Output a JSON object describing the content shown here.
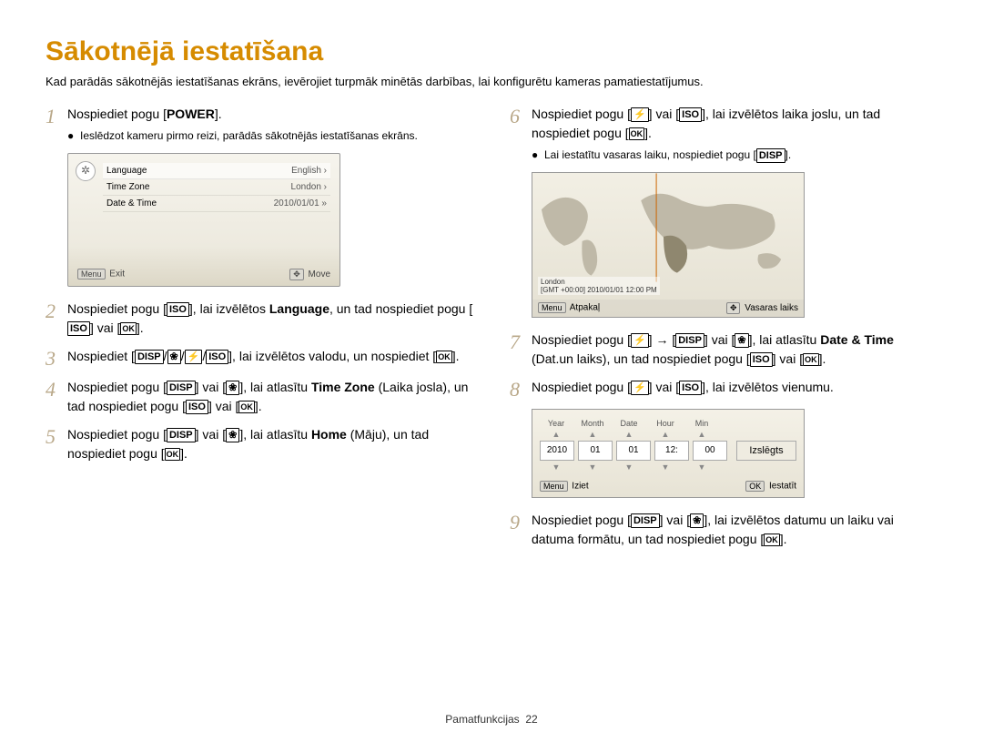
{
  "title": "Sākotnējā iestatīšana",
  "intro": "Kad parādās sākotnējās iestatīšanas ekrāns, ievērojiet turpmāk minētās darbības, lai konfigurētu kameras pamatiestatījumus.",
  "steps": {
    "s1_a": "Nospiediet pogu [",
    "s1_b": "POWER",
    "s1_c": "].",
    "s1_bullet": "Ieslēdzot kameru pirmo reizi, parādās sākotnējās iestatīšanas ekrāns.",
    "s2_a": "Nospiediet pogu [",
    "s2_b": "], lai izvēlētos ",
    "s2_lang": "Language",
    "s2_c": ", un tad nospiediet pogu [",
    "s2_d": "] vai [",
    "s2_e": "].",
    "s3_a": "Nospiediet [",
    "s3_b": "], lai izvēlētos valodu, un nospiediet [",
    "s3_c": "].",
    "s4_a": "Nospiediet pogu [",
    "s4_b": "] vai [",
    "s4_c": "], lai atlasītu ",
    "s4_tz": "Time Zone",
    "s4_d": " (Laika josla), un tad nospiediet pogu [",
    "s4_e": "] vai [",
    "s4_f": "].",
    "s5_a": "Nospiediet pogu [",
    "s5_b": "] vai [",
    "s5_c": "], lai atlasītu ",
    "s5_home": "Home",
    "s5_d": " (Māju), un tad nospiediet pogu [",
    "s5_e": "].",
    "s6_a": "Nospiediet pogu [",
    "s6_b": "] vai [",
    "s6_c": "], lai izvēlētos laika joslu, un tad nospiediet pogu [",
    "s6_d": "].",
    "s6_bullet_a": "Lai iestatītu vasaras laiku, nospiediet pogu [",
    "s6_bullet_b": "].",
    "s7_a": "Nospiediet pogu [",
    "s7_b": "] → [",
    "s7_c": "] vai [",
    "s7_d": "], lai atlasītu ",
    "s7_dt": "Date & Time",
    "s7_e": " (Dat.un laiks), un tad nospiediet pogu [",
    "s7_f": "] vai [",
    "s7_g": "].",
    "s8_a": "Nospiediet pogu [",
    "s8_b": "] vai [",
    "s8_c": "], lai izvēlētos vienumu.",
    "s9_a": "Nospiediet pogu [",
    "s9_b": "] vai [",
    "s9_c": "], lai izvēlētos datumu un laiku vai datuma formātu, un tad nospiediet pogu [",
    "s9_d": "]."
  },
  "screen1": {
    "rows": [
      {
        "label": "Language",
        "value": "English ›"
      },
      {
        "label": "Time Zone",
        "value": "London ›"
      },
      {
        "label": "Date & Time",
        "value": "2010/01/01 »"
      }
    ],
    "footer_left_btn": "Menu",
    "footer_left": "Exit",
    "footer_right": "Move"
  },
  "map": {
    "city": "London",
    "gmt": "[GMT +00:00] 2010/01/01 12:00 PM",
    "footer_left_btn": "Menu",
    "footer_left": "Atpakaļ",
    "footer_right": "Vasaras laiks"
  },
  "datetime": {
    "headers": [
      "Year",
      "Month",
      "Date",
      "Hour",
      "Min"
    ],
    "values": [
      "2010",
      "01",
      "01",
      "12:",
      "00"
    ],
    "off_label": "Izslēgts",
    "footer_left_btn": "Menu",
    "footer_left": "Iziet",
    "footer_right_btn": "OK",
    "footer_right": "Iestatīt"
  },
  "symbols": {
    "iso": "ISO",
    "ok": "OK",
    "disp": "DISP",
    "flash": "⚡",
    "macro": "❀",
    "nav": "✥"
  },
  "footer": {
    "section": "Pamatfunkcijas",
    "page": "22"
  }
}
